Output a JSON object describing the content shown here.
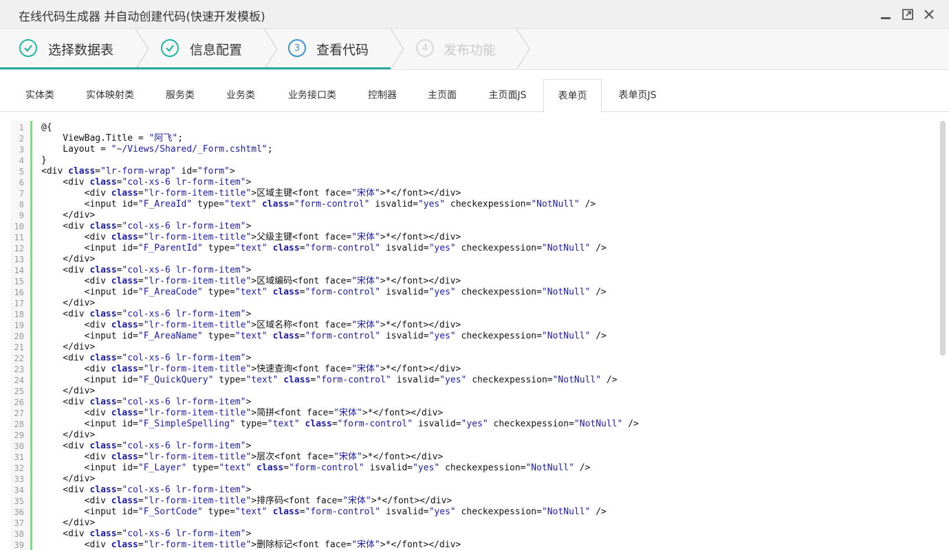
{
  "window": {
    "title": "在线代码生成器 并自动创建代码(快速开发模板)",
    "controls": [
      {
        "name": "minimize-icon"
      },
      {
        "name": "maximize-icon"
      },
      {
        "name": "close-icon"
      }
    ]
  },
  "steps": [
    {
      "label": "选择数据表",
      "status": "done",
      "icon": "check-icon"
    },
    {
      "label": "信息配置",
      "status": "done",
      "icon": "check-icon"
    },
    {
      "label": "查看代码",
      "status": "current",
      "number": "3"
    },
    {
      "label": "发布功能",
      "status": "todo",
      "number": "4"
    }
  ],
  "tabs": [
    {
      "label": "实体类"
    },
    {
      "label": "实体映射类"
    },
    {
      "label": "服务类"
    },
    {
      "label": "业务类"
    },
    {
      "label": "业务接口类"
    },
    {
      "label": "控制器"
    },
    {
      "label": "主页面"
    },
    {
      "label": "主页面JS"
    },
    {
      "label": "表单页",
      "active": true
    },
    {
      "label": "表单页JS"
    }
  ],
  "colors": {
    "accent_green": "#1fb6a0",
    "accent_blue": "#3a93d1",
    "keyword": "#1a1aa6",
    "gutter_marker": "#7ddc7d"
  },
  "code": [
    "@{",
    "    ViewBag.Title = \"阿飞\";",
    "    Layout = \"~/Views/Shared/_Form.cshtml\";",
    "}",
    "<div class=\"lr-form-wrap\" id=\"form\">",
    "    <div class=\"col-xs-6 lr-form-item\">",
    "        <div class=\"lr-form-item-title\">区域主键<font face=\"宋体\">*</font></div>",
    "        <input id=\"F_AreaId\" type=\"text\" class=\"form-control\" isvalid=\"yes\" checkexpession=\"NotNull\" />",
    "    </div>",
    "    <div class=\"col-xs-6 lr-form-item\">",
    "        <div class=\"lr-form-item-title\">父级主键<font face=\"宋体\">*</font></div>",
    "        <input id=\"F_ParentId\" type=\"text\" class=\"form-control\" isvalid=\"yes\" checkexpession=\"NotNull\" />",
    "    </div>",
    "    <div class=\"col-xs-6 lr-form-item\">",
    "        <div class=\"lr-form-item-title\">区域编码<font face=\"宋体\">*</font></div>",
    "        <input id=\"F_AreaCode\" type=\"text\" class=\"form-control\" isvalid=\"yes\" checkexpession=\"NotNull\" />",
    "    </div>",
    "    <div class=\"col-xs-6 lr-form-item\">",
    "        <div class=\"lr-form-item-title\">区域名称<font face=\"宋体\">*</font></div>",
    "        <input id=\"F_AreaName\" type=\"text\" class=\"form-control\" isvalid=\"yes\" checkexpession=\"NotNull\" />",
    "    </div>",
    "    <div class=\"col-xs-6 lr-form-item\">",
    "        <div class=\"lr-form-item-title\">快速查询<font face=\"宋体\">*</font></div>",
    "        <input id=\"F_QuickQuery\" type=\"text\" class=\"form-control\" isvalid=\"yes\" checkexpession=\"NotNull\" />",
    "    </div>",
    "    <div class=\"col-xs-6 lr-form-item\">",
    "        <div class=\"lr-form-item-title\">简拼<font face=\"宋体\">*</font></div>",
    "        <input id=\"F_SimpleSpelling\" type=\"text\" class=\"form-control\" isvalid=\"yes\" checkexpession=\"NotNull\" />",
    "    </div>",
    "    <div class=\"col-xs-6 lr-form-item\">",
    "        <div class=\"lr-form-item-title\">层次<font face=\"宋体\">*</font></div>",
    "        <input id=\"F_Layer\" type=\"text\" class=\"form-control\" isvalid=\"yes\" checkexpession=\"NotNull\" />",
    "    </div>",
    "    <div class=\"col-xs-6 lr-form-item\">",
    "        <div class=\"lr-form-item-title\">排序码<font face=\"宋体\">*</font></div>",
    "        <input id=\"F_SortCode\" type=\"text\" class=\"form-control\" isvalid=\"yes\" checkexpession=\"NotNull\" />",
    "    </div>",
    "    <div class=\"col-xs-6 lr-form-item\">",
    "        <div class=\"lr-form-item-title\">删除标记<font face=\"宋体\">*</font></div>"
  ]
}
